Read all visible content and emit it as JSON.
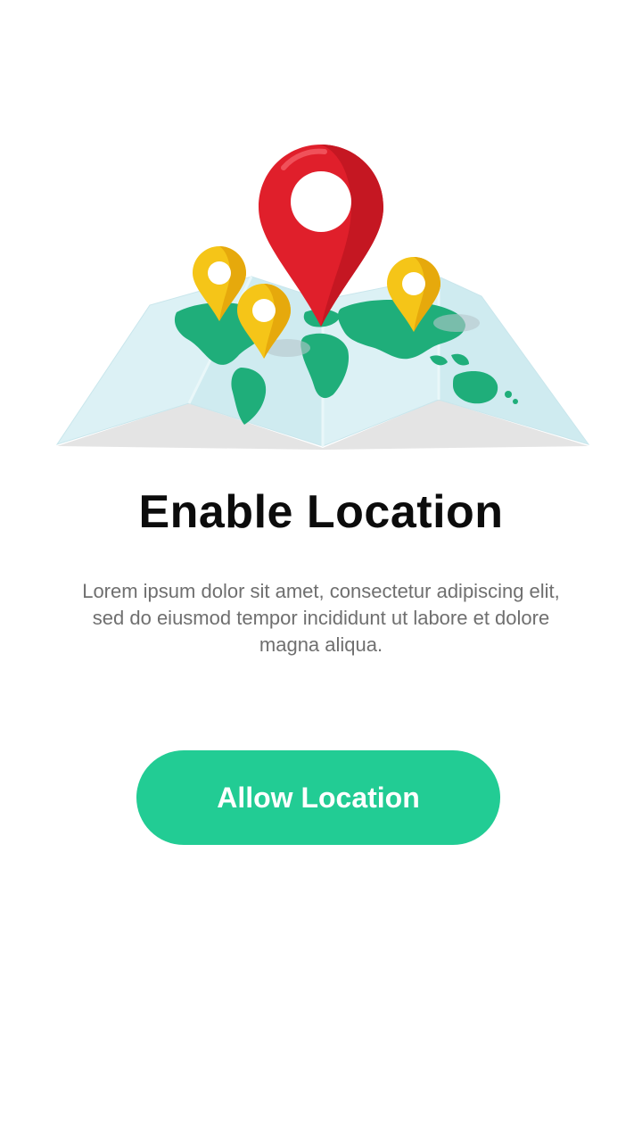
{
  "onboarding": {
    "title": "Enable Location",
    "description": "Lorem ipsum dolor sit amet, consectetur adipiscing elit, sed do eiusmod tempor incididunt ut labore et dolore magna aliqua.",
    "allow_button_label": "Allow Location"
  },
  "colors": {
    "accent": "#22cc94",
    "main_pin": "#e01f2b",
    "secondary_pins": "#f5c518",
    "map_land": "#1fae7a",
    "map_paper": "#d9f0f4",
    "title_text": "#0c0c0c",
    "body_text": "#6f6f6f"
  },
  "icons": {
    "illustration": "folded-world-map-icon",
    "main_pin": "map-pin-icon",
    "secondary_pins": "map-pin-icon"
  }
}
